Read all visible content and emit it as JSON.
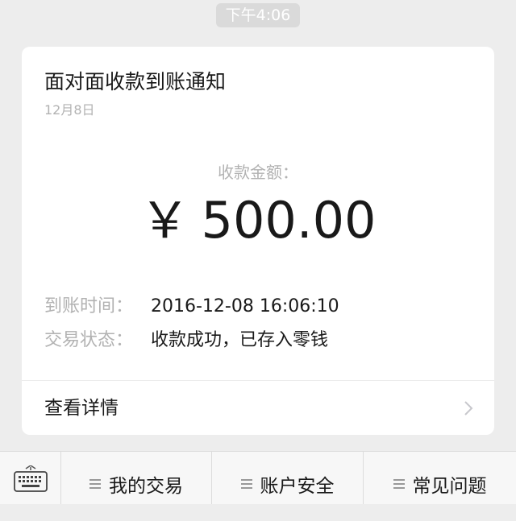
{
  "chat": {
    "timestamp": "下午4:06"
  },
  "card": {
    "title": "面对面收款到账通知",
    "date": "12月8日",
    "amount_label": "收款金额：",
    "currency": "￥",
    "amount": "500.00",
    "details": [
      {
        "key": "到账时间：",
        "value": "2016-12-08 16:06:10"
      },
      {
        "key": "交易状态：",
        "value": "收款成功，已存入零钱"
      }
    ],
    "view_details_label": "查看详情"
  },
  "bottom_menu": {
    "keyboard_icon": "keyboard-icon",
    "items": [
      {
        "label": "我的交易",
        "icon": "menu-icon"
      },
      {
        "label": "账户安全",
        "icon": "menu-icon"
      },
      {
        "label": "常见问题",
        "icon": "menu-icon"
      }
    ]
  },
  "colors": {
    "background": "#ededed",
    "card": "#ffffff",
    "primary_text": "#191919",
    "secondary_text": "#b2b2b2",
    "timestamp_pill": "#dadada"
  }
}
